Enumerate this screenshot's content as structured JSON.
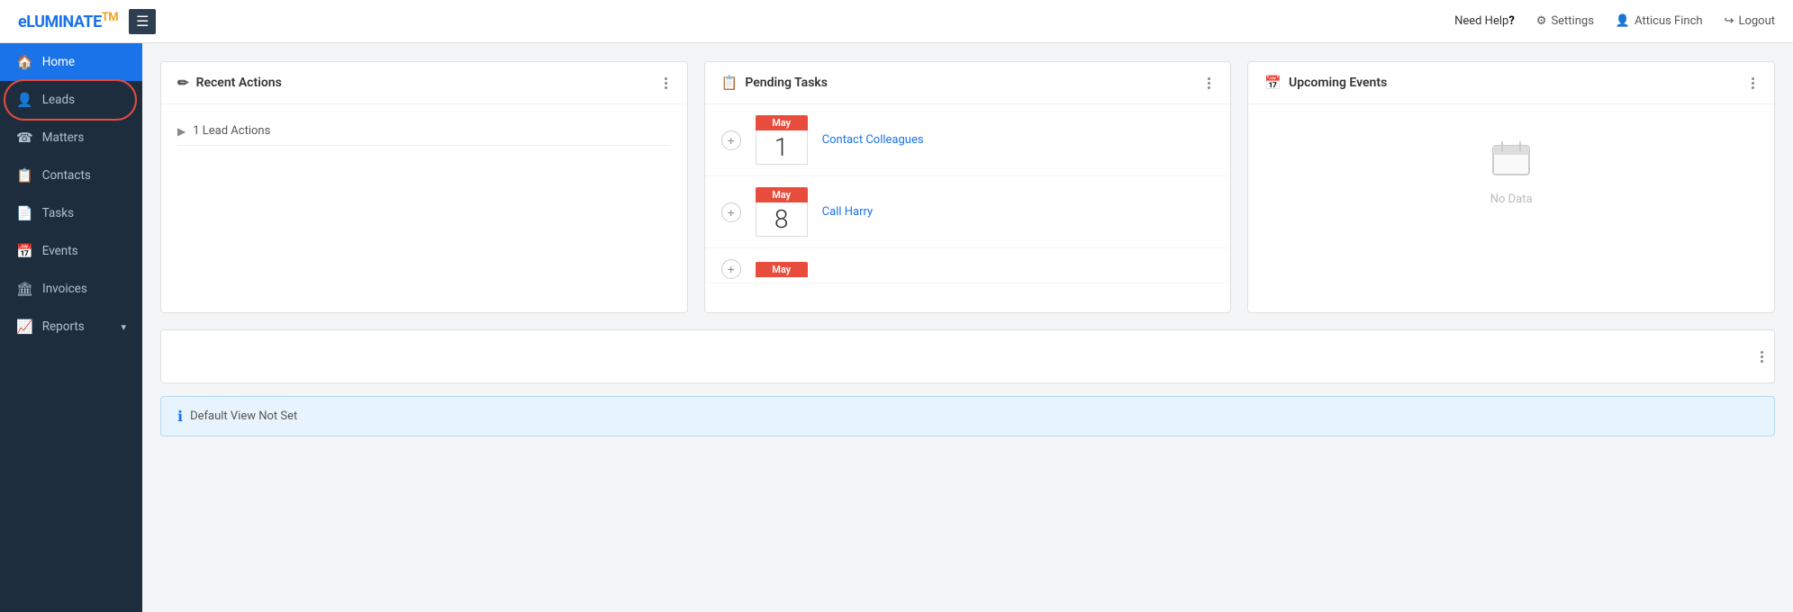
{
  "header": {
    "logo": "eLUMINATE",
    "logo_superscript": "TM",
    "need_help_label": "Need Help?",
    "settings_label": "Settings",
    "user_name": "Atticus Finch",
    "logout_label": "Logout"
  },
  "sidebar": {
    "items": [
      {
        "id": "home",
        "label": "Home",
        "icon": "🏠",
        "active": true
      },
      {
        "id": "leads",
        "label": "Leads",
        "icon": "👤",
        "active": false,
        "highlighted": true
      },
      {
        "id": "matters",
        "label": "Matters",
        "icon": "☎",
        "active": false
      },
      {
        "id": "contacts",
        "label": "Contacts",
        "icon": "📋",
        "active": false
      },
      {
        "id": "tasks",
        "label": "Tasks",
        "icon": "📄",
        "active": false
      },
      {
        "id": "events",
        "label": "Events",
        "icon": "📅",
        "active": false
      },
      {
        "id": "invoices",
        "label": "Invoices",
        "icon": "🏛",
        "active": false
      },
      {
        "id": "reports",
        "label": "Reports",
        "icon": "📈",
        "active": false,
        "has_chevron": true
      }
    ]
  },
  "recent_actions": {
    "title": "Recent Actions",
    "icon": "✏",
    "lead_actions_label": "1 Lead Actions"
  },
  "pending_tasks": {
    "title": "Pending Tasks",
    "icon": "📋",
    "tasks": [
      {
        "month": "May",
        "day": "1",
        "label": "Contact Colleagues"
      },
      {
        "month": "May",
        "day": "8",
        "label": "Call Harry"
      },
      {
        "month": "May",
        "day": "",
        "label": ""
      }
    ]
  },
  "upcoming_events": {
    "title": "Upcoming Events",
    "icon": "📅",
    "no_data_label": "No Data"
  },
  "info_bar": {
    "message": "Default View Not Set",
    "icon": "ℹ"
  }
}
